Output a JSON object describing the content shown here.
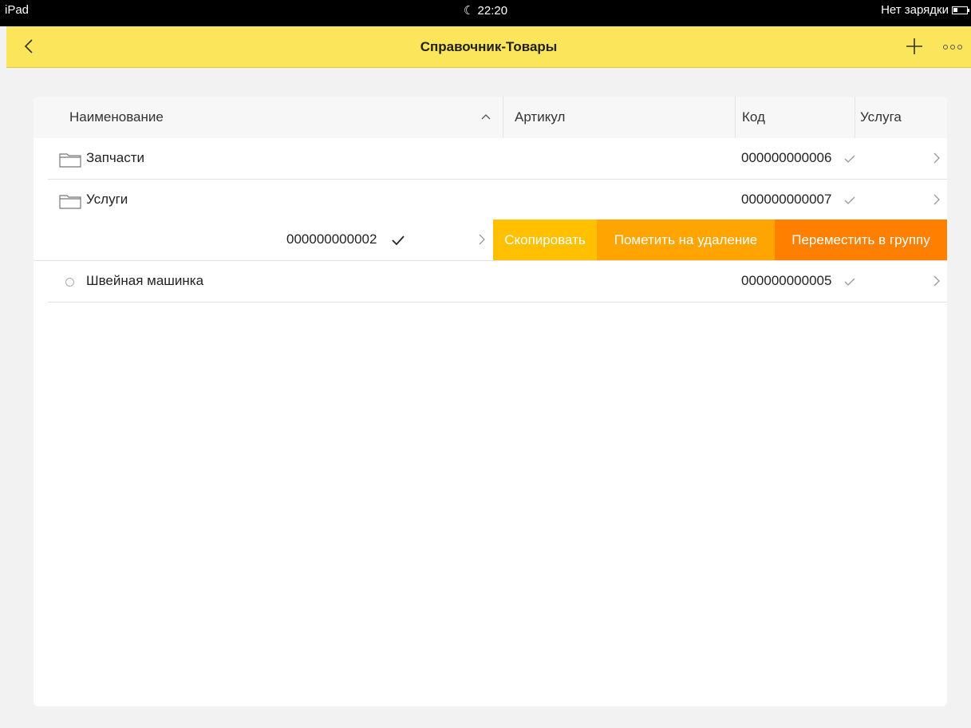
{
  "status_bar": {
    "device": "iPad",
    "time": "22:20",
    "battery_text": "Нет зарядки"
  },
  "nav": {
    "title": "Справочник-Товары",
    "back_icon": "chevron-left-icon",
    "add_icon": "plus-icon",
    "more_icon": "more-icon"
  },
  "table": {
    "columns": [
      "Наименование",
      "Артикул",
      "Код",
      "Услуга"
    ],
    "sort_icon": "chevron-up-icon",
    "rows": [
      {
        "name": "Запчасти",
        "code": "000000000006",
        "type": "folder"
      },
      {
        "name": "Услуги",
        "code": "000000000007",
        "type": "folder"
      },
      {
        "name": "Швейная машинка",
        "code": "000000000005",
        "type": "item"
      }
    ],
    "swiped_row": {
      "code": "000000000002",
      "actions": {
        "copy": "Скопировать",
        "mark_delete": "Пометить на удаление",
        "move": "Переместить в группу"
      }
    }
  },
  "colors": {
    "nav_bg": "#fbe55a",
    "copy": "#ffc000",
    "mark_delete": "#ffa400",
    "move": "#ff8000"
  }
}
